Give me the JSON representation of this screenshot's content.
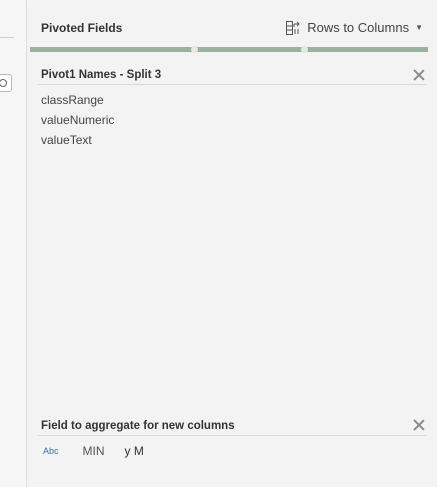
{
  "header": {
    "title": "Pivoted Fields",
    "rows_to_columns_label": "Rows to Columns"
  },
  "pivot_names": {
    "title": "Pivot1 Names - Split 3",
    "fields": [
      "classRange",
      "valueNumeric",
      "valueText"
    ]
  },
  "aggregate": {
    "title": "Field to aggregate for new columns",
    "type_badge": "Abc",
    "function": "MIN",
    "field": "y M"
  },
  "colors": {
    "accent_bar": "#9bb09f",
    "type_badge": "#3b6fa3"
  }
}
